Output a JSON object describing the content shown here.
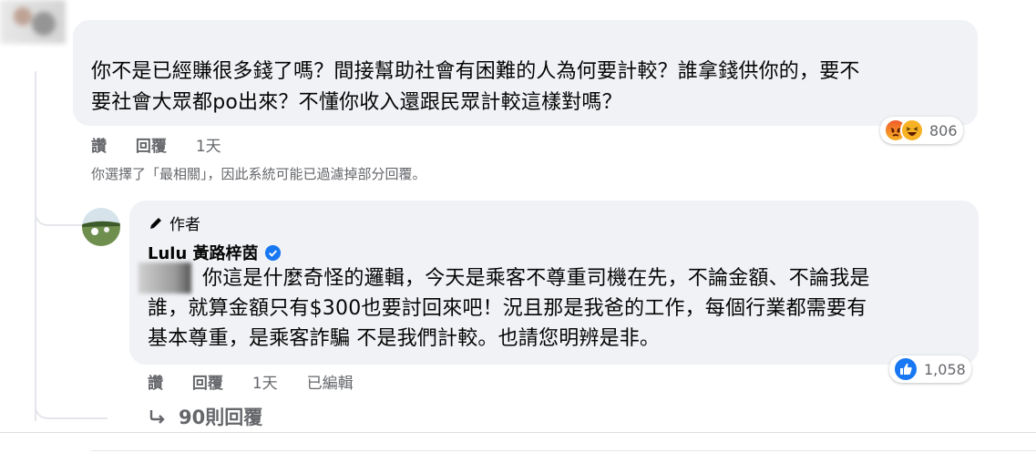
{
  "comment": {
    "text_line1": "你不是已經賺很多錢了嗎？間接幫助社會有困難的人為何要計較？誰拿錢供你的，要不",
    "text_line2": "要社會大眾都po出來？不懂你收入還跟民眾計較這樣對嗎？",
    "actions": {
      "like_label": "讚",
      "reply_label": "回覆",
      "time": "1天"
    },
    "reactions": {
      "icons": [
        "angry-icon",
        "haha-icon"
      ],
      "count": "806"
    }
  },
  "filter_note": "你選擇了「最相關」，因此系統可能已過濾掉部分回覆。",
  "reply": {
    "author_badge": "作者",
    "author_name": "Lulu 黃路梓茵",
    "verified": true,
    "text_line1": "你這是什麼奇怪的邏輯，今天是乘客不尊重司機在先，不論金額、不論我是",
    "text_line2": "誰，就算金額只有$300也要討回來吧！況且那是我爸的工作，每個行業都需要有",
    "text_line3": "基本尊重，是乘客詐騙 不是我們計較。也請您明辨是非。",
    "actions": {
      "like_label": "讚",
      "reply_label": "回覆",
      "time": "1天",
      "edited_label": "已編輯"
    },
    "reactions": {
      "icons": [
        "like-icon"
      ],
      "count": "1,058"
    }
  },
  "more_replies": "90則回覆",
  "colors": {
    "bubble": "#f0f2f5",
    "secondary_text": "#65676b",
    "like_blue": "#1877f2",
    "verified_blue": "#1877f2"
  }
}
